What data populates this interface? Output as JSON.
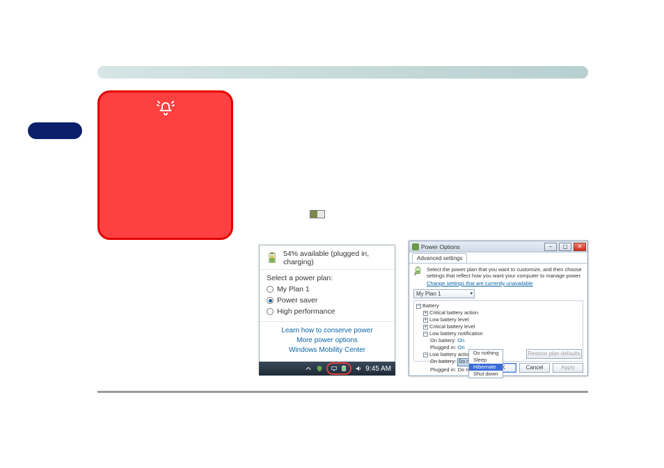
{
  "popup": {
    "status": "54% available (plugged in, charging)",
    "section_label": "Select a power plan:",
    "plans": [
      "My Plan 1",
      "Power saver",
      "High performance"
    ],
    "links": [
      "Learn how to conserve power",
      "More power options",
      "Windows Mobility Center"
    ]
  },
  "taskbar": {
    "clock": "9:45 AM"
  },
  "dialog": {
    "title": "Power Options",
    "tab": "Advanced settings",
    "description": "Select the power plan that you want to customize, and then choose settings that reflect how you want your computer to manage power.",
    "change_link": "Change settings that are currently unavailable",
    "plan_combo": "My Plan 1",
    "tree": {
      "root": "Battery",
      "n1": "Critical battery action",
      "n2": "Low battery level",
      "n3": "Critical battery level",
      "n4": "Low battery notification",
      "n4a_label": "On battery:",
      "n4a_val": "On",
      "n4b_label": "Plugged in:",
      "n4b_val": "On",
      "n5": "Low battery action",
      "n5a_label": "On battery:",
      "n5a_val": "Do nothing",
      "n5b_label": "Plugged in:",
      "n5b_val": "Do nothing"
    },
    "dropdown_opts": [
      "Do nothing",
      "Sleep",
      "Hibernate",
      "Shut down"
    ],
    "restore_btn": "Restore plan defaults",
    "ok": "OK",
    "cancel": "Cancel",
    "apply": "Apply"
  }
}
